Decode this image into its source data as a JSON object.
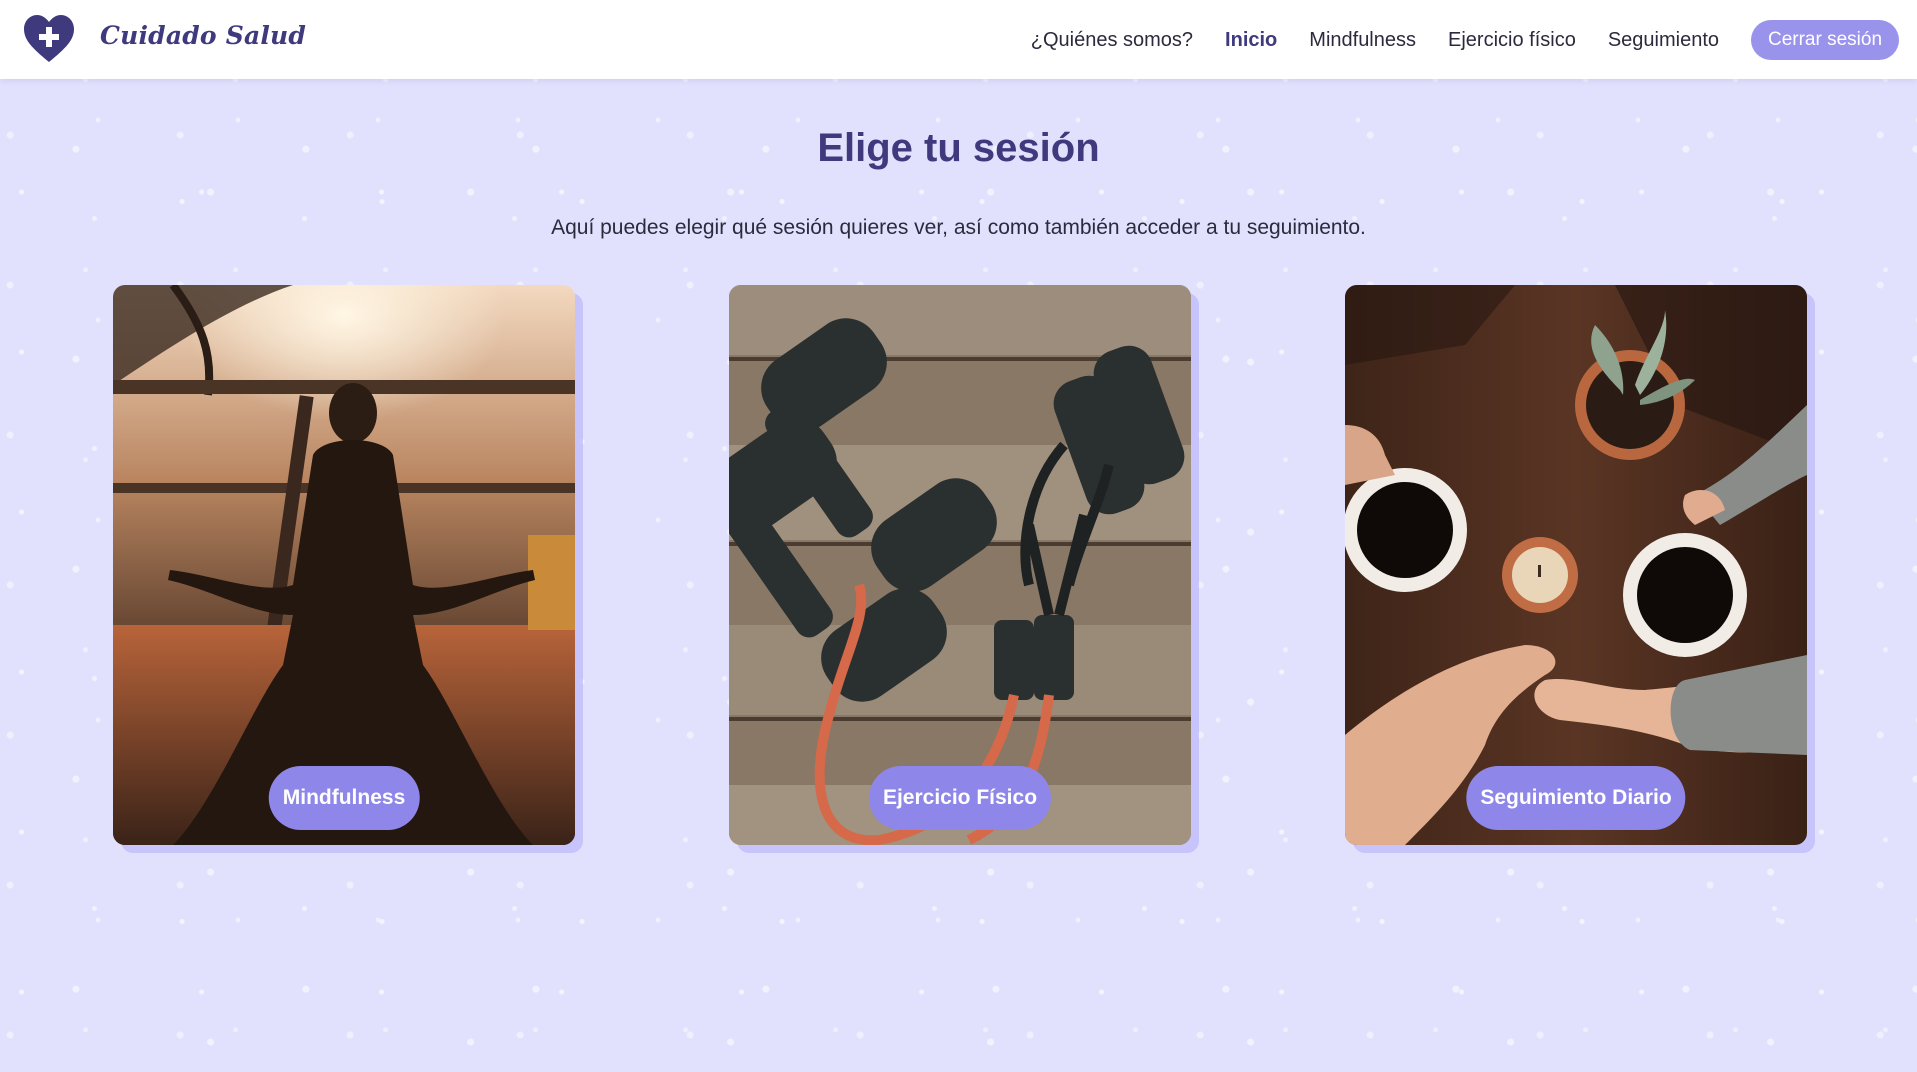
{
  "brand": {
    "name": "Cuidado Salud",
    "logo_icon": "heart-plus-icon",
    "accent": "#3f3a7d"
  },
  "nav": {
    "items": [
      {
        "label": "¿Quiénes somos?",
        "active": false
      },
      {
        "label": "Inicio",
        "active": true
      },
      {
        "label": "Mindfulness",
        "active": false
      },
      {
        "label": "Ejercicio físico",
        "active": false
      },
      {
        "label": "Seguimiento",
        "active": false
      }
    ],
    "logout_label": "Cerrar sesión",
    "logout_color": "#9a93ec"
  },
  "main": {
    "title": "Elige tu sesión",
    "subtitle": "Aquí puedes elegir qué sesión quieres ver, así como también acceder a tu seguimiento.",
    "background": "#e2e1fd"
  },
  "cards": [
    {
      "button": "Mindfulness",
      "image": "meditation-sunset-photo"
    },
    {
      "button": "Ejercicio Físico",
      "image": "dumbbells-resistance-band-photo"
    },
    {
      "button": "Seguimiento Diario",
      "image": "coffee-hands-table-photo"
    }
  ],
  "button_color": "#8f86e9"
}
